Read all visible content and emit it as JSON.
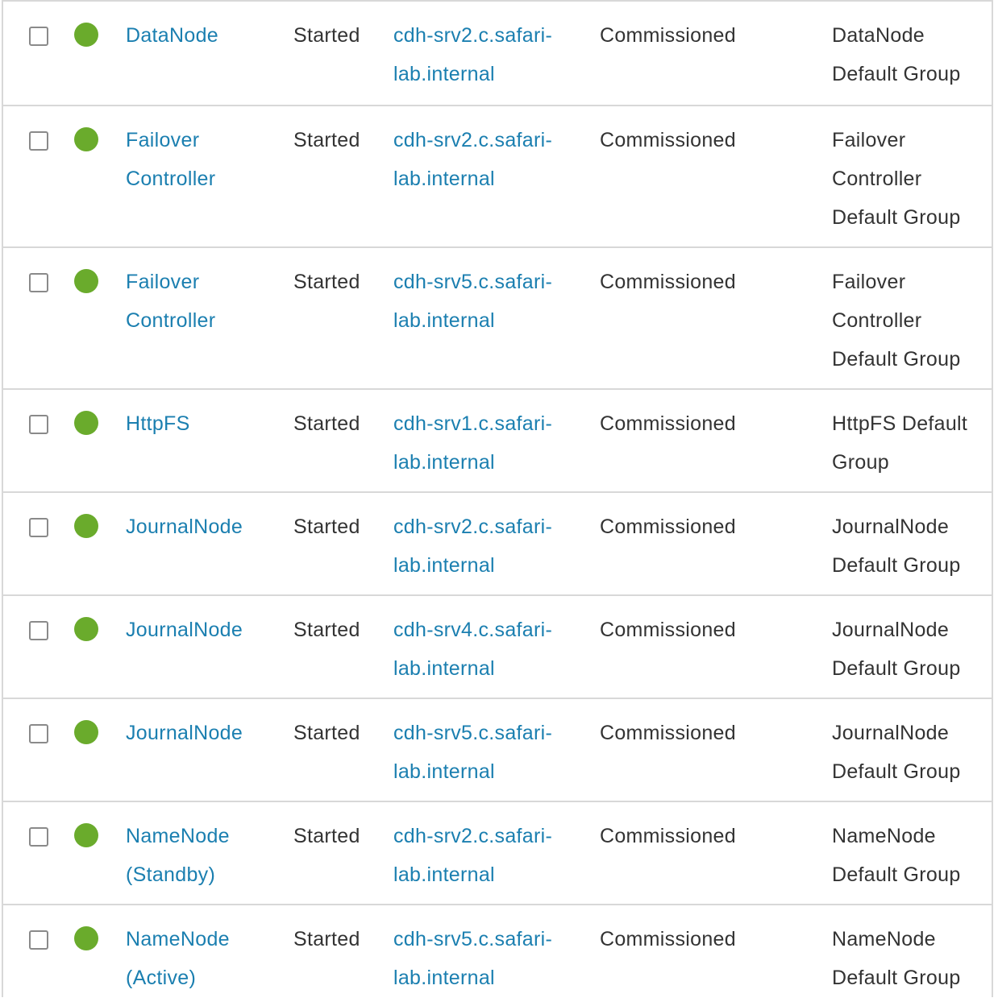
{
  "theme": {
    "status_color": "#6aab2c",
    "link_color": "#1b7fb0",
    "text_color": "#333333",
    "border_color": "#d8d8d8"
  },
  "rows": [
    {
      "role_lines": [
        "DataNode"
      ],
      "state": "Started",
      "host_lines": [
        "cdh-srv2.c.safari-",
        "lab.internal"
      ],
      "commission": "Commissioned",
      "group_lines": [
        "DataNode",
        "Default Group"
      ],
      "status_icon": "status-good-icon"
    },
    {
      "role_lines": [
        "Failover",
        "Controller"
      ],
      "state": "Started",
      "host_lines": [
        "cdh-srv2.c.safari-",
        "lab.internal"
      ],
      "commission": "Commissioned",
      "group_lines": [
        "Failover",
        "Controller",
        "Default Group"
      ],
      "status_icon": "status-good-icon"
    },
    {
      "role_lines": [
        "Failover",
        "Controller"
      ],
      "state": "Started",
      "host_lines": [
        "cdh-srv5.c.safari-",
        "lab.internal"
      ],
      "commission": "Commissioned",
      "group_lines": [
        "Failover",
        "Controller",
        "Default Group"
      ],
      "status_icon": "status-good-icon"
    },
    {
      "role_lines": [
        "HttpFS"
      ],
      "state": "Started",
      "host_lines": [
        "cdh-srv1.c.safari-",
        "lab.internal"
      ],
      "commission": "Commissioned",
      "group_lines": [
        "HttpFS Default",
        "Group"
      ],
      "status_icon": "status-good-icon"
    },
    {
      "role_lines": [
        "JournalNode"
      ],
      "state": "Started",
      "host_lines": [
        "cdh-srv2.c.safari-",
        "lab.internal"
      ],
      "commission": "Commissioned",
      "group_lines": [
        "JournalNode",
        "Default Group"
      ],
      "status_icon": "status-good-icon"
    },
    {
      "role_lines": [
        "JournalNode"
      ],
      "state": "Started",
      "host_lines": [
        "cdh-srv4.c.safari-",
        "lab.internal"
      ],
      "commission": "Commissioned",
      "group_lines": [
        "JournalNode",
        "Default Group"
      ],
      "status_icon": "status-good-icon"
    },
    {
      "role_lines": [
        "JournalNode"
      ],
      "state": "Started",
      "host_lines": [
        "cdh-srv5.c.safari-",
        "lab.internal"
      ],
      "commission": "Commissioned",
      "group_lines": [
        "JournalNode",
        "Default Group"
      ],
      "status_icon": "status-good-icon"
    },
    {
      "role_lines": [
        "NameNode",
        "(Standby)"
      ],
      "state": "Started",
      "host_lines": [
        "cdh-srv2.c.safari-",
        "lab.internal"
      ],
      "commission": "Commissioned",
      "group_lines": [
        "NameNode",
        "Default Group"
      ],
      "status_icon": "status-good-icon"
    },
    {
      "role_lines": [
        "NameNode",
        "(Active)"
      ],
      "state": "Started",
      "host_lines": [
        "cdh-srv5.c.safari-",
        "lab.internal"
      ],
      "commission": "Commissioned",
      "group_lines": [
        "NameNode",
        "Default Group"
      ],
      "status_icon": "status-good-icon"
    }
  ]
}
